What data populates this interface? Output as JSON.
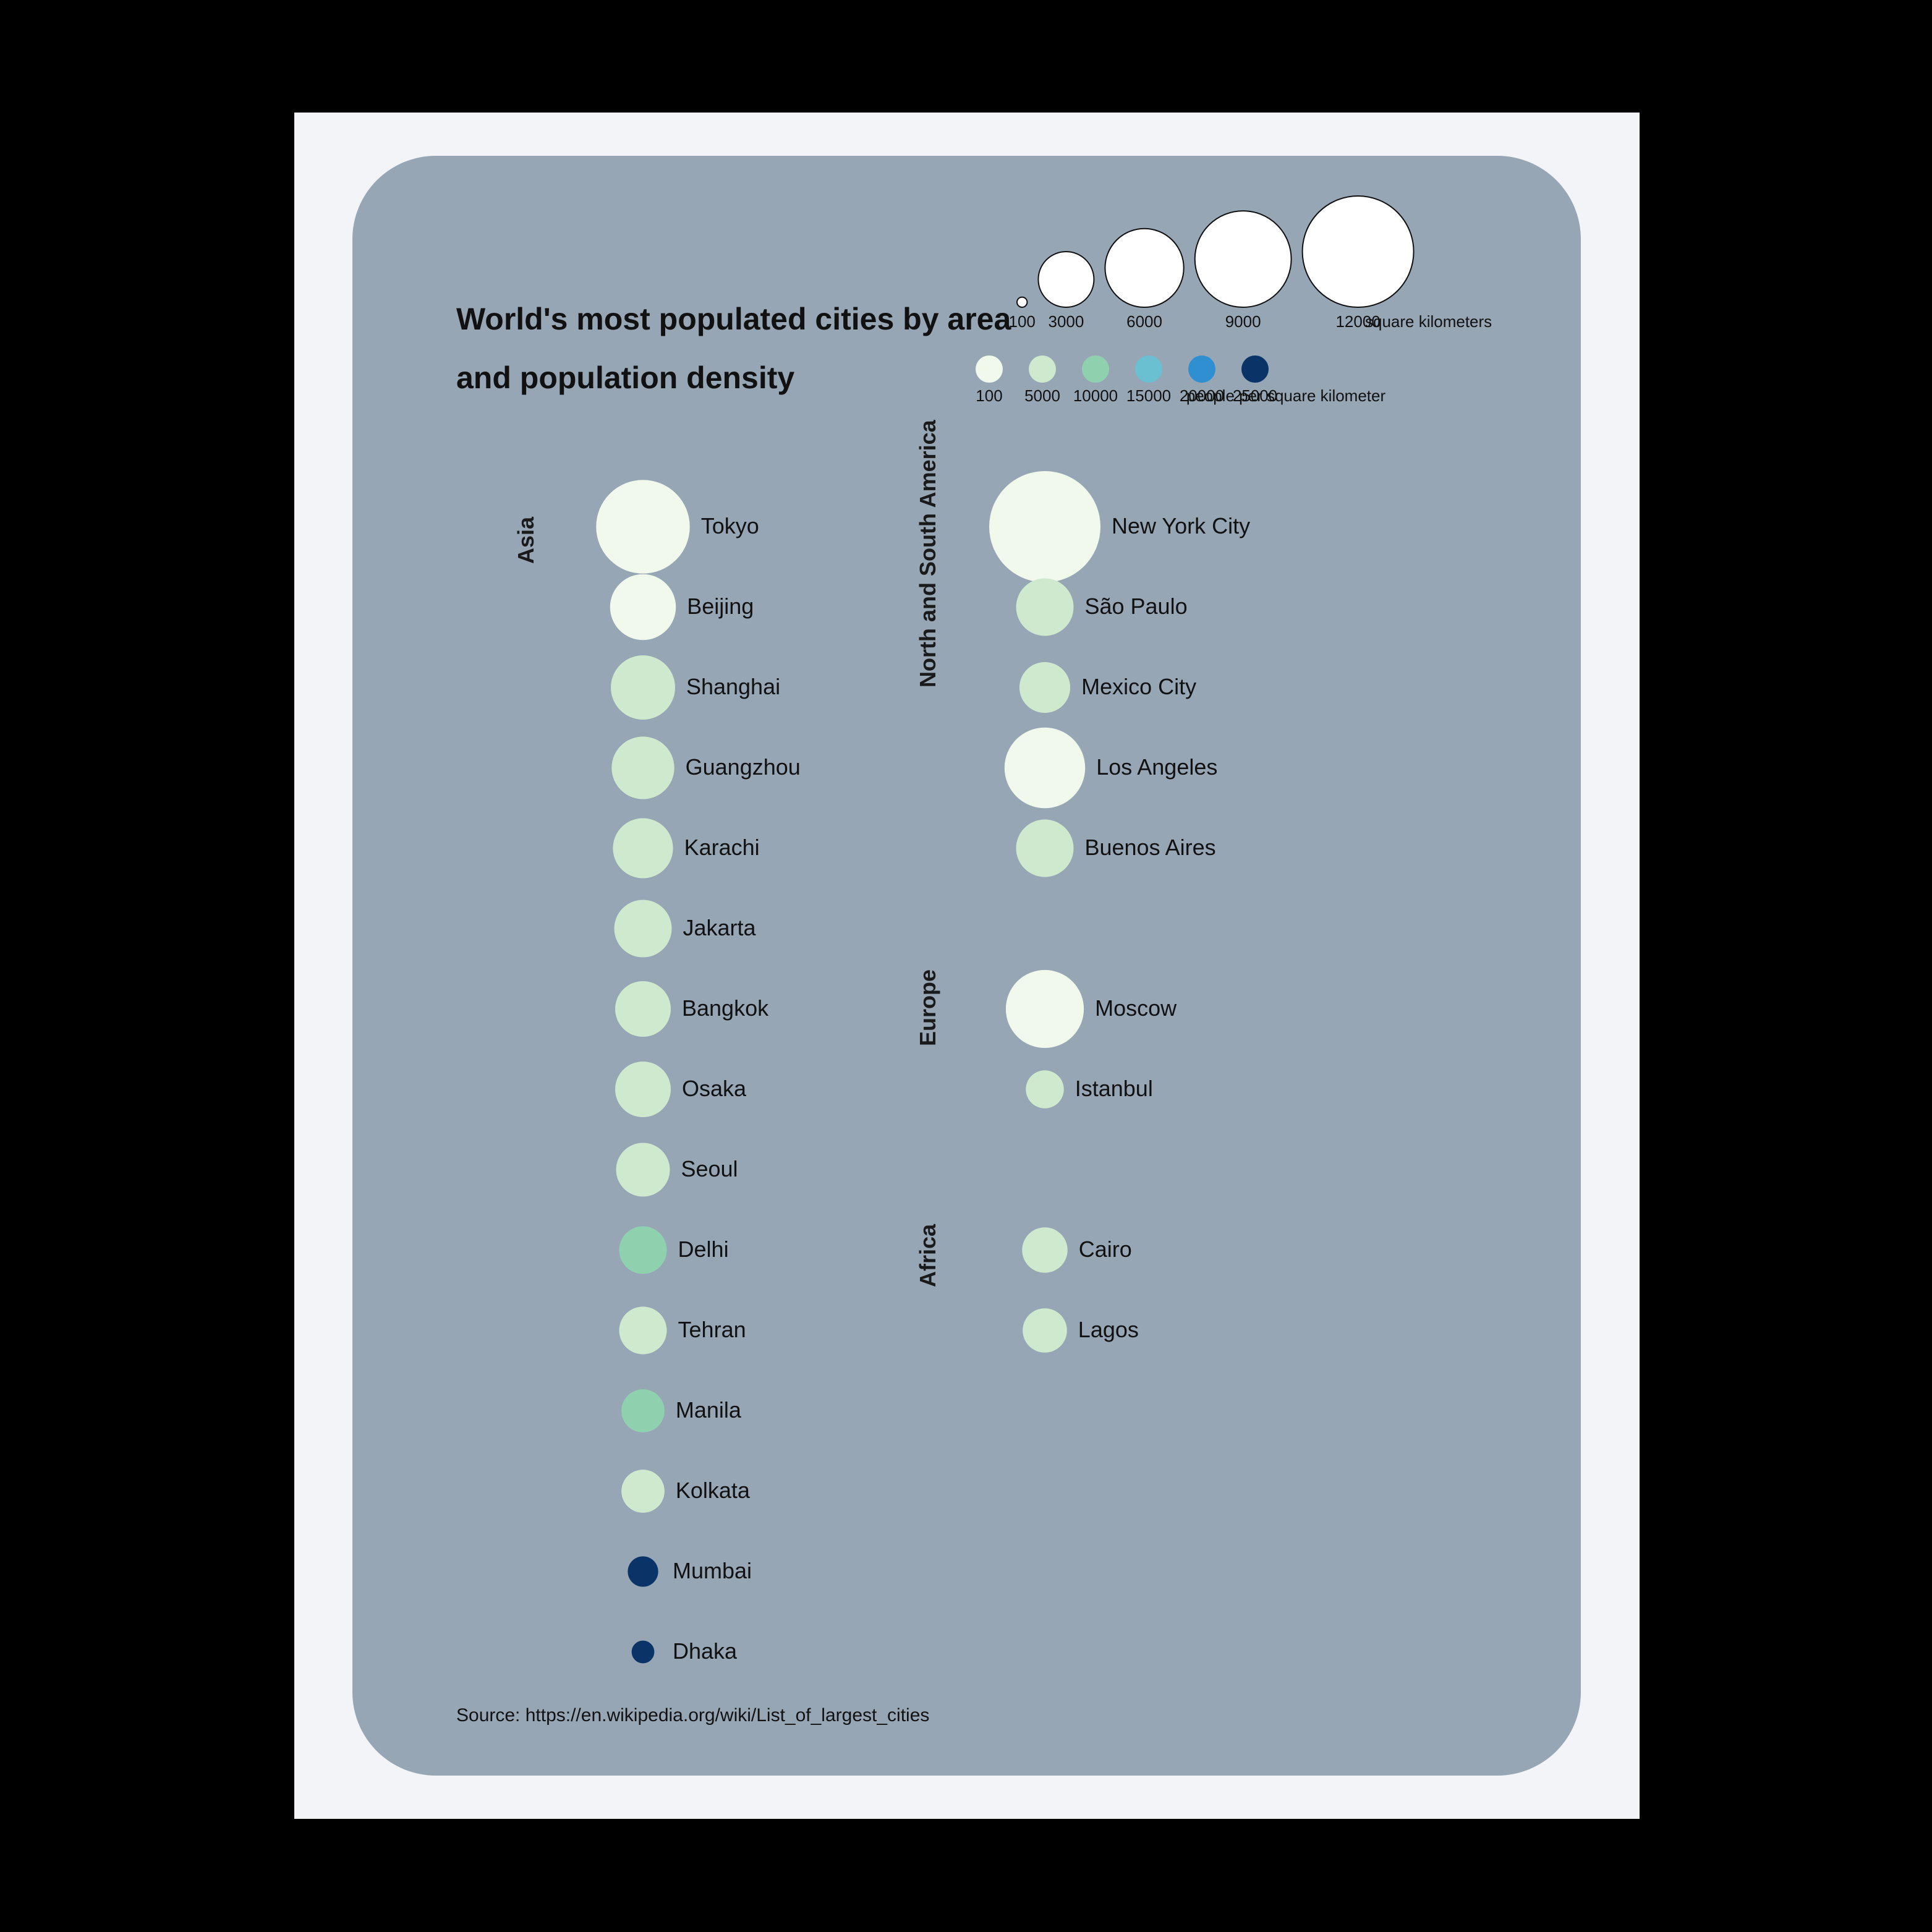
{
  "title_line1": "World's most populated cities by area",
  "title_line2": "and population density",
  "source": "Source: https://en.wikipedia.org/wiki/List_of_largest_cities",
  "legend_size": {
    "values": [
      "100",
      "3000",
      "6000",
      "9000",
      "12000"
    ],
    "unit": "square kilometers"
  },
  "legend_color": {
    "values": [
      "100",
      "5000",
      "10000",
      "15000",
      "20000",
      "25000"
    ],
    "colors": [
      "#f0f9ec",
      "#cfe9cf",
      "#8fd0ae",
      "#6abfd1",
      "#2f8fd0",
      "#0a3468"
    ],
    "unit": "people per square kilometer"
  },
  "regions": [
    {
      "name": "Asia",
      "col": 0,
      "row": 0
    },
    {
      "name": "North and South America",
      "col": 1,
      "row": 0
    },
    {
      "name": "Europe",
      "col": 1,
      "row": 6
    },
    {
      "name": "Africa",
      "col": 1,
      "row": 9
    }
  ],
  "cities_col0": [
    {
      "name": "Tokyo",
      "area": 8500,
      "density": 4500
    },
    {
      "name": "Beijing",
      "area": 4200,
      "density": 4800
    },
    {
      "name": "Shanghai",
      "area": 4000,
      "density": 6000
    },
    {
      "name": "Guangzhou",
      "area": 3800,
      "density": 6000
    },
    {
      "name": "Karachi",
      "area": 3500,
      "density": 5500
    },
    {
      "name": "Jakarta",
      "area": 3200,
      "density": 9500
    },
    {
      "name": "Bangkok",
      "area": 3000,
      "density": 5500
    },
    {
      "name": "Osaka",
      "area": 3000,
      "density": 5000
    },
    {
      "name": "Seoul",
      "area": 2800,
      "density": 7000
    },
    {
      "name": "Delhi",
      "area": 2200,
      "density": 12000
    },
    {
      "name": "Tehran",
      "area": 2200,
      "density": 6500
    },
    {
      "name": "Manila",
      "area": 1800,
      "density": 14000
    },
    {
      "name": "Kolkata",
      "area": 1800,
      "density": 8500
    },
    {
      "name": "Mumbai",
      "area": 900,
      "density": 25000
    },
    {
      "name": "Dhaka",
      "area": 500,
      "density": 25000
    }
  ],
  "cities_col1": [
    {
      "row": 0,
      "name": "New York City",
      "area": 12000,
      "density": 2000
    },
    {
      "row": 1,
      "name": "São Paulo",
      "area": 3200,
      "density": 7000
    },
    {
      "row": 2,
      "name": "Mexico City",
      "area": 2500,
      "density": 8500
    },
    {
      "row": 3,
      "name": "Los Angeles",
      "area": 6300,
      "density": 2500
    },
    {
      "row": 4,
      "name": "Buenos Aires",
      "area": 3200,
      "density": 5500
    },
    {
      "row": 6,
      "name": "Moscow",
      "area": 5900,
      "density": 3000
    },
    {
      "row": 7,
      "name": "Istanbul",
      "area": 1400,
      "density": 9500
    },
    {
      "row": 9,
      "name": "Cairo",
      "area": 2000,
      "density": 8500
    },
    {
      "row": 10,
      "name": "Lagos",
      "area": 1900,
      "density": 7000
    }
  ],
  "chart_data": {
    "type": "other",
    "title": "World's most populated cities by area and population density",
    "size_encoding": "area in square kilometers",
    "color_encoding": "population density in people per square kilometer",
    "series": [
      {
        "region": "Asia",
        "city": "Tokyo",
        "area_km2": 8500,
        "density_ppkm2": 4500
      },
      {
        "region": "Asia",
        "city": "Beijing",
        "area_km2": 4200,
        "density_ppkm2": 4800
      },
      {
        "region": "Asia",
        "city": "Shanghai",
        "area_km2": 4000,
        "density_ppkm2": 6000
      },
      {
        "region": "Asia",
        "city": "Guangzhou",
        "area_km2": 3800,
        "density_ppkm2": 6000
      },
      {
        "region": "Asia",
        "city": "Karachi",
        "area_km2": 3500,
        "density_ppkm2": 5500
      },
      {
        "region": "Asia",
        "city": "Jakarta",
        "area_km2": 3200,
        "density_ppkm2": 9500
      },
      {
        "region": "Asia",
        "city": "Bangkok",
        "area_km2": 3000,
        "density_ppkm2": 5500
      },
      {
        "region": "Asia",
        "city": "Osaka",
        "area_km2": 3000,
        "density_ppkm2": 5000
      },
      {
        "region": "Asia",
        "city": "Seoul",
        "area_km2": 2800,
        "density_ppkm2": 7000
      },
      {
        "region": "Asia",
        "city": "Delhi",
        "area_km2": 2200,
        "density_ppkm2": 12000
      },
      {
        "region": "Asia",
        "city": "Tehran",
        "area_km2": 2200,
        "density_ppkm2": 6500
      },
      {
        "region": "Asia",
        "city": "Manila",
        "area_km2": 1800,
        "density_ppkm2": 14000
      },
      {
        "region": "Asia",
        "city": "Kolkata",
        "area_km2": 1800,
        "density_ppkm2": 8500
      },
      {
        "region": "Asia",
        "city": "Mumbai",
        "area_km2": 900,
        "density_ppkm2": 25000
      },
      {
        "region": "Asia",
        "city": "Dhaka",
        "area_km2": 500,
        "density_ppkm2": 25000
      },
      {
        "region": "North and South America",
        "city": "New York City",
        "area_km2": 12000,
        "density_ppkm2": 2000
      },
      {
        "region": "North and South America",
        "city": "São Paulo",
        "area_km2": 3200,
        "density_ppkm2": 7000
      },
      {
        "region": "North and South America",
        "city": "Mexico City",
        "area_km2": 2500,
        "density_ppkm2": 8500
      },
      {
        "region": "North and South America",
        "city": "Los Angeles",
        "area_km2": 6300,
        "density_ppkm2": 2500
      },
      {
        "region": "North and South America",
        "city": "Buenos Aires",
        "area_km2": 3200,
        "density_ppkm2": 5500
      },
      {
        "region": "Europe",
        "city": "Moscow",
        "area_km2": 5900,
        "density_ppkm2": 3000
      },
      {
        "region": "Europe",
        "city": "Istanbul",
        "area_km2": 1400,
        "density_ppkm2": 9500
      },
      {
        "region": "Africa",
        "city": "Cairo",
        "area_km2": 2000,
        "density_ppkm2": 8500
      },
      {
        "region": "Africa",
        "city": "Lagos",
        "area_km2": 1900,
        "density_ppkm2": 7000
      }
    ],
    "size_legend": {
      "values": [
        100,
        3000,
        6000,
        9000,
        12000
      ],
      "unit": "square kilometers"
    },
    "color_legend": {
      "values": [
        100,
        5000,
        10000,
        15000,
        20000,
        25000
      ],
      "unit": "people per square kilometer"
    }
  }
}
